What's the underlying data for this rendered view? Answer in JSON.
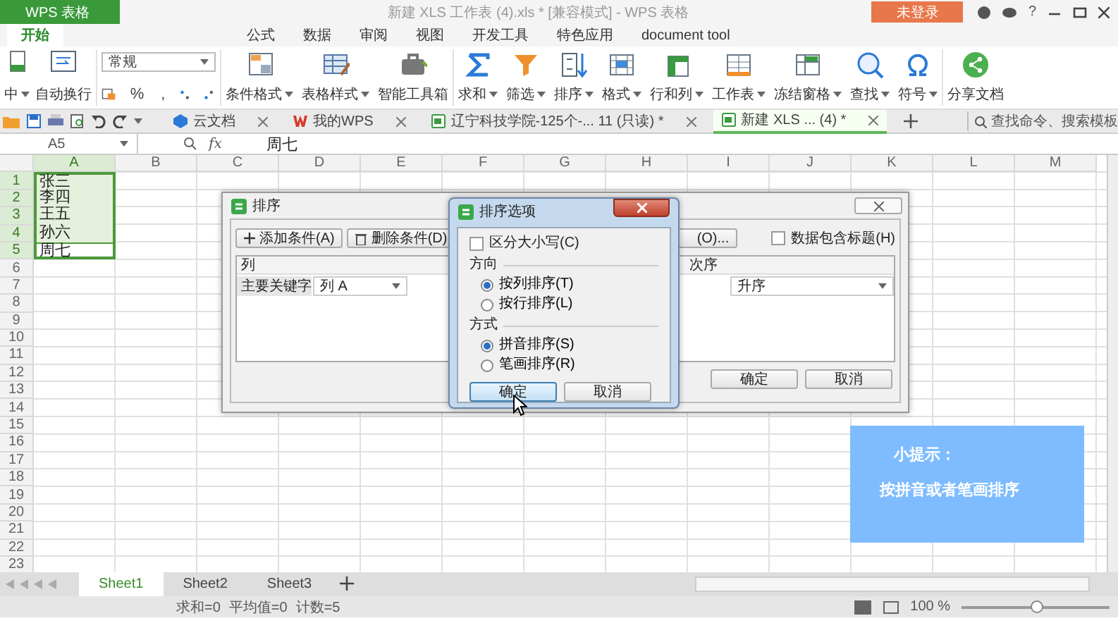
{
  "window": {
    "app_label": "WPS 表格",
    "title": "新建 XLS 工作表 (4).xls * [兼容模式] - WPS 表格",
    "login_button": "未登录",
    "help": "?"
  },
  "menu_tabs": [
    {
      "label": "开始",
      "selected": true
    },
    {
      "label": "公式",
      "selected": false
    },
    {
      "label": "数据",
      "selected": false
    },
    {
      "label": "审阅",
      "selected": false
    },
    {
      "label": "视图",
      "selected": false
    },
    {
      "label": "开发工具",
      "selected": false
    },
    {
      "label": "特色应用",
      "selected": false
    },
    {
      "label": "document tool",
      "selected": false
    }
  ],
  "ribbon": {
    "left_items": [
      {
        "label": "中",
        "dropdown": true
      },
      {
        "label": "自动换行",
        "dropdown": false
      }
    ],
    "number_format": {
      "value": "常规",
      "buttons": [
        "%",
        ","
      ]
    },
    "items": [
      {
        "label": "条件格式",
        "dropdown": true
      },
      {
        "label": "表格样式",
        "dropdown": true
      },
      {
        "label": "智能工具箱",
        "dropdown": false
      },
      {
        "label": "求和",
        "dropdown": true
      },
      {
        "label": "筛选",
        "dropdown": true
      },
      {
        "label": "排序",
        "dropdown": true
      },
      {
        "label": "格式",
        "dropdown": true
      },
      {
        "label": "行和列",
        "dropdown": true
      },
      {
        "label": "工作表",
        "dropdown": true
      },
      {
        "label": "冻结窗格",
        "dropdown": true
      },
      {
        "label": "查找",
        "dropdown": true
      },
      {
        "label": "符号",
        "dropdown": true
      },
      {
        "label": "分享文档",
        "dropdown": false
      }
    ]
  },
  "doc_tabs": [
    {
      "label": "云文档",
      "selected": false
    },
    {
      "label": "我的WPS",
      "selected": false
    },
    {
      "label": "辽宁科技学院-125个-...  11 (只读) *",
      "selected": false
    },
    {
      "label": "新建 XLS ... (4) *",
      "selected": true
    }
  ],
  "command_search": {
    "placeholder": "查找命令、搜索模板"
  },
  "formula_bar": {
    "name_box": "A5",
    "fx": "fx",
    "value": "周七"
  },
  "sheet": {
    "columns": [
      {
        "label": "A",
        "selected": true
      },
      {
        "label": "B",
        "selected": false
      },
      {
        "label": "C",
        "selected": false
      },
      {
        "label": "D",
        "selected": false
      },
      {
        "label": "E",
        "selected": false
      },
      {
        "label": "F",
        "selected": false
      },
      {
        "label": "G",
        "selected": false
      },
      {
        "label": "H",
        "selected": false
      },
      {
        "label": "I",
        "selected": false
      },
      {
        "label": "J",
        "selected": false
      },
      {
        "label": "K",
        "selected": false
      },
      {
        "label": "L",
        "selected": false
      },
      {
        "label": "M",
        "selected": false
      }
    ],
    "rows": [
      {
        "number": "1",
        "cells": [
          {
            "text": "张三",
            "active": false
          }
        ],
        "selected": true
      },
      {
        "number": "2",
        "cells": [
          {
            "text": "李四",
            "active": false
          }
        ],
        "selected": true
      },
      {
        "number": "3",
        "cells": [
          {
            "text": "王五",
            "active": false
          }
        ],
        "selected": true
      },
      {
        "number": "4",
        "cells": [
          {
            "text": "孙六",
            "active": false
          }
        ],
        "selected": true
      },
      {
        "number": "5",
        "cells": [
          {
            "text": "周七",
            "active": true
          }
        ],
        "selected": true
      },
      {
        "number": "6",
        "selected": false
      },
      {
        "number": "7",
        "selected": false
      },
      {
        "number": "8",
        "selected": false
      },
      {
        "number": "9",
        "selected": false
      },
      {
        "number": "10",
        "selected": false
      },
      {
        "number": "11",
        "selected": false
      },
      {
        "number": "12",
        "selected": false
      },
      {
        "number": "13",
        "selected": false
      },
      {
        "number": "14",
        "selected": false
      },
      {
        "number": "15",
        "selected": false
      },
      {
        "number": "16",
        "selected": false
      },
      {
        "number": "17",
        "selected": false
      },
      {
        "number": "18",
        "selected": false
      },
      {
        "number": "19",
        "selected": false
      },
      {
        "number": "20",
        "selected": false
      },
      {
        "number": "21",
        "selected": false
      },
      {
        "number": "22",
        "selected": false
      },
      {
        "number": "23",
        "selected": false
      }
    ]
  },
  "sort_dialog": {
    "title": "排序",
    "add_button": "添加条件(A)",
    "delete_button": "删除条件(D)",
    "options_button": "(O)...",
    "has_header": {
      "label": "数据包含标题(H)",
      "checked": false
    },
    "column_header": "列",
    "order_header": "次序",
    "key_label": "主要关键字",
    "key_value": "列 A",
    "order_value": "升序",
    "ok": "确定",
    "cancel": "取消"
  },
  "options_dialog": {
    "title": "排序选项",
    "case_sensitive": {
      "label": "区分大小写(C)",
      "checked": false
    },
    "direction": {
      "title": "方向",
      "options": [
        {
          "label": "按列排序(T)",
          "selected": true
        },
        {
          "label": "按行排序(L)",
          "selected": false
        }
      ]
    },
    "method": {
      "title": "方式",
      "options": [
        {
          "label": "拼音排序(S)",
          "selected": true
        },
        {
          "label": "笔画排序(R)",
          "selected": false
        }
      ]
    },
    "ok": "确定",
    "cancel": "取消"
  },
  "tip": {
    "title": "小提示：",
    "text": "按拼音或者笔画排序"
  },
  "sheet_tabs": [
    {
      "label": "Sheet1",
      "selected": true
    },
    {
      "label": "Sheet2",
      "selected": false
    },
    {
      "label": "Sheet3",
      "selected": false
    }
  ],
  "status_bar": {
    "sum": "求和=0",
    "average": "平均值=0",
    "count": "计数=5",
    "zoom": "100 %",
    "zoom_level": {
      "level": 0.5
    }
  }
}
